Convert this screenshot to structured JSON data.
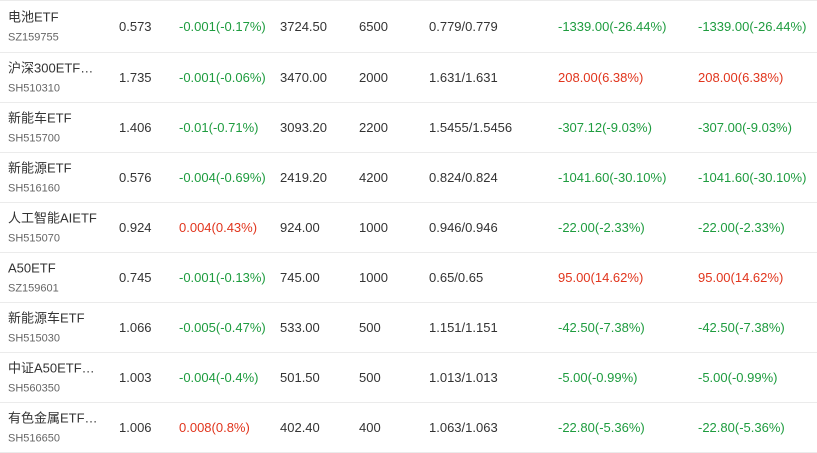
{
  "colors": {
    "up": "#e1351d",
    "down": "#1e9c3f"
  },
  "rows": [
    {
      "name": "电池ETF",
      "code": "SZ159755",
      "price": "0.573",
      "change": "-0.001(-0.17%)",
      "change_dir": "down",
      "market_value": "3724.50",
      "quantity": "6500",
      "cost": "0.779/0.779",
      "pnl": "-1339.00(-26.44%)",
      "pnl_dir": "down",
      "pnl2": "-1339.00(-26.44%)",
      "pnl2_dir": "down"
    },
    {
      "name": "沪深300ETF…",
      "code": "SH510310",
      "price": "1.735",
      "change": "-0.001(-0.06%)",
      "change_dir": "down",
      "market_value": "3470.00",
      "quantity": "2000",
      "cost": "1.631/1.631",
      "pnl": "208.00(6.38%)",
      "pnl_dir": "up",
      "pnl2": "208.00(6.38%)",
      "pnl2_dir": "up"
    },
    {
      "name": "新能车ETF",
      "code": "SH515700",
      "price": "1.406",
      "change": "-0.01(-0.71%)",
      "change_dir": "down",
      "market_value": "3093.20",
      "quantity": "2200",
      "cost": "1.5455/1.5456",
      "pnl": "-307.12(-9.03%)",
      "pnl_dir": "down",
      "pnl2": "-307.00(-9.03%)",
      "pnl2_dir": "down"
    },
    {
      "name": "新能源ETF",
      "code": "SH516160",
      "price": "0.576",
      "change": "-0.004(-0.69%)",
      "change_dir": "down",
      "market_value": "2419.20",
      "quantity": "4200",
      "cost": "0.824/0.824",
      "pnl": "-1041.60(-30.10%)",
      "pnl_dir": "down",
      "pnl2": "-1041.60(-30.10%)",
      "pnl2_dir": "down"
    },
    {
      "name": "人工智能AIETF",
      "code": "SH515070",
      "price": "0.924",
      "change": "0.004(0.43%)",
      "change_dir": "up",
      "market_value": "924.00",
      "quantity": "1000",
      "cost": "0.946/0.946",
      "pnl": "-22.00(-2.33%)",
      "pnl_dir": "down",
      "pnl2": "-22.00(-2.33%)",
      "pnl2_dir": "down"
    },
    {
      "name": "A50ETF",
      "code": "SZ159601",
      "price": "0.745",
      "change": "-0.001(-0.13%)",
      "change_dir": "down",
      "market_value": "745.00",
      "quantity": "1000",
      "cost": "0.65/0.65",
      "pnl": "95.00(14.62%)",
      "pnl_dir": "up",
      "pnl2": "95.00(14.62%)",
      "pnl2_dir": "up"
    },
    {
      "name": "新能源车ETF",
      "code": "SH515030",
      "price": "1.066",
      "change": "-0.005(-0.47%)",
      "change_dir": "down",
      "market_value": "533.00",
      "quantity": "500",
      "cost": "1.151/1.151",
      "pnl": "-42.50(-7.38%)",
      "pnl_dir": "down",
      "pnl2": "-42.50(-7.38%)",
      "pnl2_dir": "down"
    },
    {
      "name": "中证A50ETF…",
      "code": "SH560350",
      "price": "1.003",
      "change": "-0.004(-0.4%)",
      "change_dir": "down",
      "market_value": "501.50",
      "quantity": "500",
      "cost": "1.013/1.013",
      "pnl": "-5.00(-0.99%)",
      "pnl_dir": "down",
      "pnl2": "-5.00(-0.99%)",
      "pnl2_dir": "down"
    },
    {
      "name": "有色金属ETF…",
      "code": "SH516650",
      "price": "1.006",
      "change": "0.008(0.8%)",
      "change_dir": "up",
      "market_value": "402.40",
      "quantity": "400",
      "cost": "1.063/1.063",
      "pnl": "-22.80(-5.36%)",
      "pnl_dir": "down",
      "pnl2": "-22.80(-5.36%)",
      "pnl2_dir": "down"
    }
  ]
}
